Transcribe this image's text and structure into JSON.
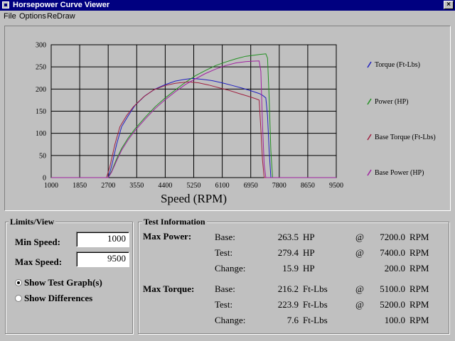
{
  "window": {
    "title": "Horsepower Curve Viewer",
    "close_glyph": "×"
  },
  "menu": [
    {
      "label": "File"
    },
    {
      "label": "Options"
    },
    {
      "label": "ReDraw"
    }
  ],
  "chart_data": {
    "type": "line",
    "xlabel": "Speed (RPM)",
    "xlim": [
      1000,
      9500
    ],
    "ylim": [
      0,
      300
    ],
    "x_ticks": [
      1000,
      1850,
      2700,
      3550,
      4400,
      5250,
      6100,
      6950,
      7800,
      8650,
      9500
    ],
    "y_ticks": [
      0,
      50,
      100,
      150,
      200,
      250,
      300
    ],
    "grid": true,
    "legend_position": "right",
    "series": [
      {
        "name": "Torque (Ft-Lbs)",
        "color": "#2020c0",
        "dashed": false,
        "x": [
          1000,
          2700,
          2800,
          2950,
          3100,
          3300,
          3500,
          3800,
          4100,
          4400,
          4700,
          5000,
          5200,
          5500,
          5800,
          6100,
          6400,
          6700,
          7000,
          7200,
          7300,
          7400,
          7450,
          7500,
          7550,
          9500
        ],
        "y": [
          0,
          0,
          25,
          75,
          115,
          140,
          163,
          185,
          200,
          210,
          218,
          222,
          223.9,
          222,
          219,
          214,
          208,
          202,
          195,
          190,
          186,
          180,
          140,
          60,
          0,
          0
        ]
      },
      {
        "name": "Power (HP)",
        "color": "#209020",
        "dashed": false,
        "x": [
          1000,
          2700,
          2800,
          2950,
          3100,
          3300,
          3500,
          3800,
          4100,
          4400,
          4700,
          5000,
          5300,
          5600,
          5900,
          6200,
          6500,
          6800,
          7000,
          7200,
          7400,
          7450,
          7500,
          7550,
          7600,
          9500
        ],
        "y": [
          0,
          0,
          14,
          42,
          66,
          90,
          110,
          136,
          160,
          180,
          198,
          215,
          230,
          242,
          253,
          261,
          268,
          274,
          276,
          278,
          279.4,
          270,
          180,
          60,
          0,
          0
        ]
      },
      {
        "name": "Base Torque (Ft-Lbs)",
        "color": "#a02040",
        "dashed": false,
        "x": [
          1000,
          2650,
          2750,
          2900,
          3050,
          3250,
          3450,
          3750,
          4050,
          4400,
          4700,
          5000,
          5100,
          5400,
          5700,
          6000,
          6300,
          6600,
          6900,
          7100,
          7200,
          7250,
          7300,
          7350,
          9500
        ],
        "y": [
          0,
          0,
          25,
          75,
          115,
          140,
          160,
          182,
          198,
          208,
          213,
          215.5,
          216.2,
          214,
          209,
          203,
          197,
          190,
          183,
          178,
          175,
          110,
          40,
          0,
          0
        ]
      },
      {
        "name": "Base Power (HP)",
        "color": "#a020a0",
        "dashed": false,
        "x": [
          1000,
          2700,
          2800,
          2950,
          3100,
          3300,
          3500,
          3800,
          4100,
          4400,
          4700,
          5000,
          5300,
          5600,
          5900,
          6200,
          6500,
          6800,
          7000,
          7200,
          7250,
          7300,
          7350,
          7400,
          9500
        ],
        "y": [
          0,
          0,
          12,
          38,
          62,
          86,
          106,
          132,
          156,
          176,
          194,
          210,
          223,
          235,
          245,
          253,
          259,
          262,
          263,
          263.5,
          240,
          120,
          30,
          0,
          0
        ]
      }
    ]
  },
  "limits": {
    "title": "Limits/View",
    "min_speed_label": "Min Speed:",
    "min_speed_value": "1000",
    "max_speed_label": "Max Speed:",
    "max_speed_value": "9500",
    "radio_test_label": "Show Test Graph(s)",
    "radio_diff_label": "Show Differences",
    "selected": "test"
  },
  "test_info": {
    "title": "Test Information",
    "max_power_label": "Max Power:",
    "max_torque_label": "Max Torque:",
    "power_rows": [
      {
        "label": "Base:",
        "value": "263.5",
        "unit": "HP",
        "at": "@",
        "rpm": "7200.0",
        "rpm_unit": "RPM"
      },
      {
        "label": "Test:",
        "value": "279.4",
        "unit": "HP",
        "at": "@",
        "rpm": "7400.0",
        "rpm_unit": "RPM"
      },
      {
        "label": "Change:",
        "value": "15.9",
        "unit": "HP",
        "at": "",
        "rpm": "200.0",
        "rpm_unit": "RPM"
      }
    ],
    "torque_rows": [
      {
        "label": "Base:",
        "value": "216.2",
        "unit": "Ft-Lbs",
        "at": "@",
        "rpm": "5100.0",
        "rpm_unit": "RPM"
      },
      {
        "label": "Test:",
        "value": "223.9",
        "unit": "Ft-Lbs",
        "at": "@",
        "rpm": "5200.0",
        "rpm_unit": "RPM"
      },
      {
        "label": "Change:",
        "value": "7.6",
        "unit": "Ft-Lbs",
        "at": "",
        "rpm": "100.0",
        "rpm_unit": "RPM"
      }
    ]
  }
}
